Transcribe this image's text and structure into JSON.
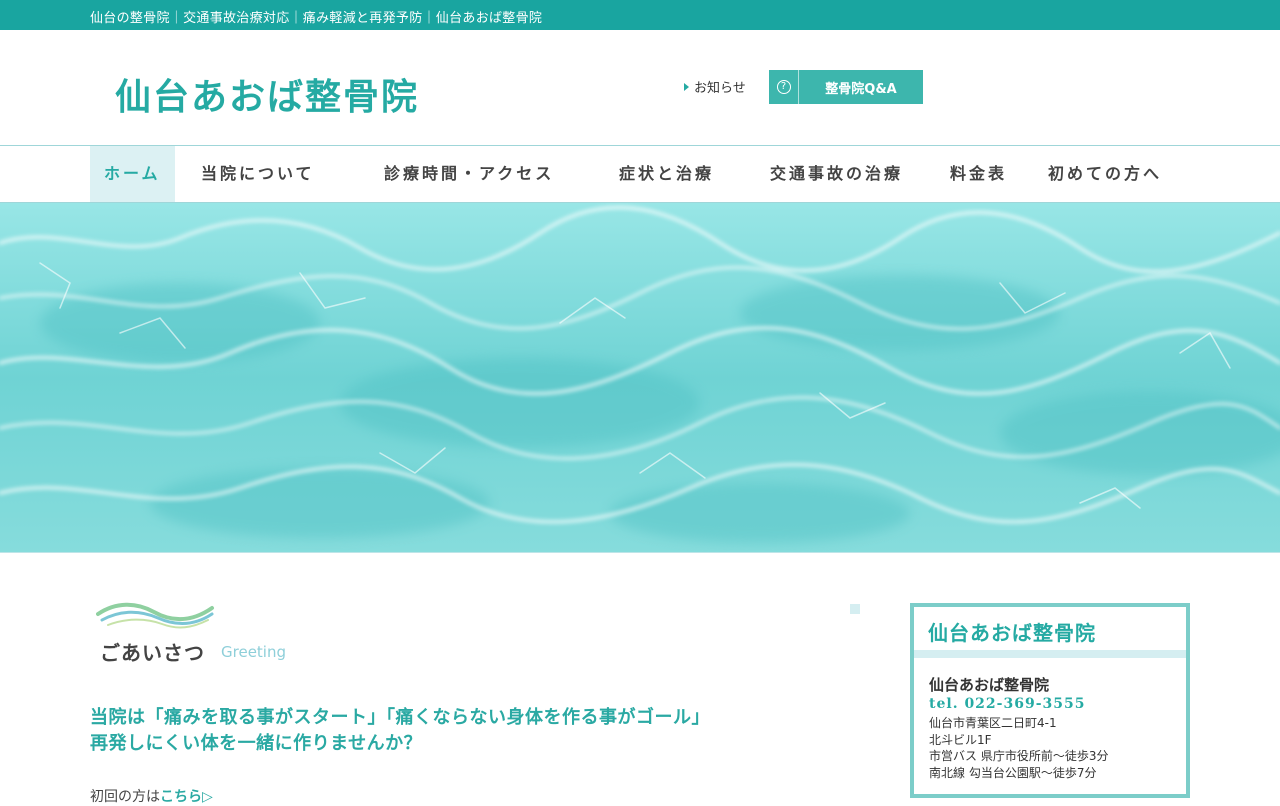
{
  "topbar": {
    "tagline": "仙台の整骨院｜交通事故治療対応｜痛み軽減と再発予防｜仙台あおば整骨院"
  },
  "header": {
    "logo_text": "仙台あおば整骨院",
    "news_link": "お知らせ",
    "qa_button": "整骨院Q&A",
    "qa_icon_glyph": "?"
  },
  "nav": {
    "items": [
      {
        "label": "ホーム"
      },
      {
        "label": "当院について"
      },
      {
        "label": "診療時間・アクセス"
      },
      {
        "label": "症状と治療"
      },
      {
        "label": "交通事故の治療"
      },
      {
        "label": "料金表"
      },
      {
        "label": "初めての方へ"
      }
    ],
    "active_index": 0
  },
  "greeting": {
    "title": "ごあいさつ",
    "title_en": "Greeting",
    "lead_line1": "当院は「痛みを取る事がスタート」「痛くならない身体を作る事がゴール」",
    "lead_line2": "再発しにくい体を一緒に作りませんか？",
    "first_visit_prefix": "初回の方は",
    "first_visit_link": "こちら▷"
  },
  "sidebox": {
    "title": "仙台あおば整骨院",
    "name": "仙台あおば整骨院",
    "tel": "tel. 022-369-3555",
    "address_line1": "仙台市青葉区二日町4-1",
    "address_line2": "北斗ビル1F",
    "access_line1": "市営バス 県庁市役所前～徒歩3分",
    "access_line2": "南北線 勾当台公園駅～徒歩7分"
  },
  "colors": {
    "accent": "#19a5a0",
    "accent_light": "#dcf1f3",
    "hero_water": "#7fdcdc"
  }
}
